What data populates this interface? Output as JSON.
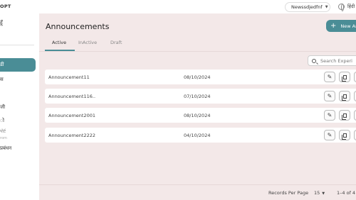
{
  "app": {
    "brand": "OPT"
  },
  "header": {
    "org_select": "Newssdjedfnf",
    "language": "हिंदी"
  },
  "sidebar": {
    "top_item": "हूँ",
    "active_item": "डी",
    "items": [
      {
        "label": "स"
      },
      {
        "label": "जी"
      },
      {
        "label": "ो"
      },
      {
        "label": "पोर्ट"
      },
      {
        "label": "rom"
      },
      {
        "label": "प्रबंधन"
      }
    ]
  },
  "main": {
    "title": "Announcements",
    "new_button": "New An",
    "tabs": [
      {
        "label": "Active",
        "active": true
      },
      {
        "label": "InActive",
        "active": false
      },
      {
        "label": "Draft",
        "active": false
      }
    ],
    "search_placeholder": "Search Experi",
    "rows": [
      {
        "name": "Announcement11",
        "date": "08/10/2024"
      },
      {
        "name": "Announcement116..",
        "date": "07/10/2024"
      },
      {
        "name": "Announcement2001",
        "date": "08/10/2024"
      },
      {
        "name": "Announcement2222",
        "date": "04/10/2024"
      }
    ],
    "footer": {
      "records_per_page_label": "Records Per Page",
      "records_per_page_value": "15",
      "range": "1–4 of 4"
    }
  },
  "colors": {
    "accent": "#4a8d96",
    "main_bg": "#f3e8e8"
  }
}
